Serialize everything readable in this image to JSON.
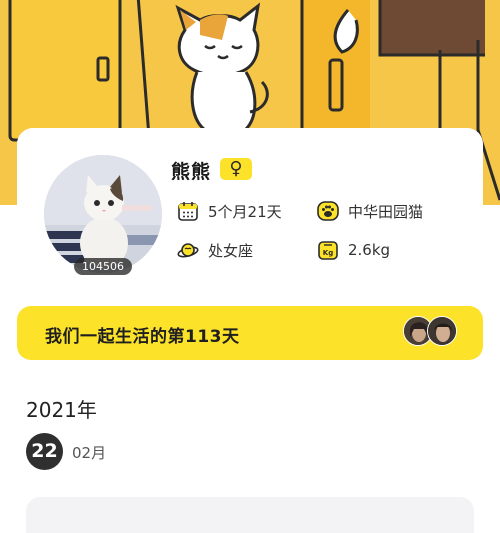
{
  "profile": {
    "name": "熊熊",
    "gender_symbol": "♀",
    "id_badge": "104506",
    "age": "5个月21天",
    "breed": "中华田园猫",
    "zodiac": "处女座",
    "weight": "2.6kg"
  },
  "together": {
    "text": "我们一起生活的第113天"
  },
  "timeline": {
    "year": "2021年",
    "day": "22",
    "month": "02月"
  },
  "icons": {
    "age": "calendar-icon",
    "breed": "paw-icon",
    "zodiac": "zodiac-icon",
    "weight": "scale-icon"
  },
  "colors": {
    "header_bg": "#f6c648",
    "accent_yellow": "#fde22a",
    "dark": "#2f2f2f"
  }
}
